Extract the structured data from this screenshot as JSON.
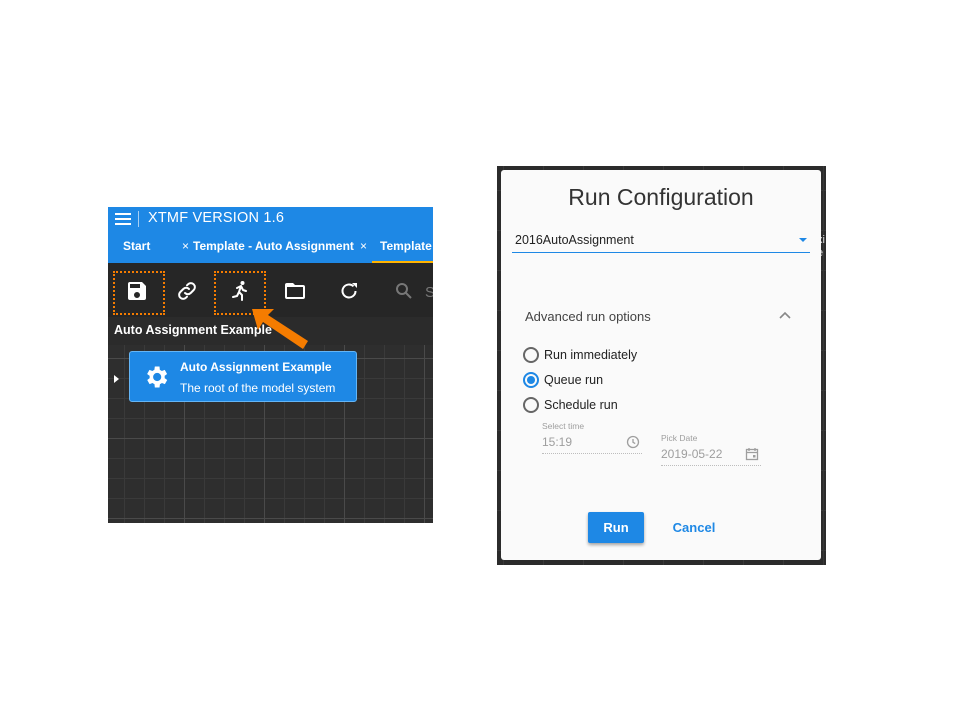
{
  "xtmf": {
    "app_title": "XTMF VERSION 1.6",
    "tabs": [
      {
        "label": "Start",
        "close": "×"
      },
      {
        "label": "Template - Auto Assignment",
        "close": "×"
      },
      {
        "label": "Template"
      }
    ],
    "toolbar": {
      "search_hint": "S"
    },
    "breadcrumb": "Auto Assignment Example",
    "node": {
      "title": "Auto Assignment Example",
      "subtitle": "The root of the model system"
    },
    "highlight_color": "#f57c00",
    "accent_color": "#1e88e5"
  },
  "dialog": {
    "title": "Run Configuration",
    "selected_config": "2016AutoAssignment",
    "advanced_label": "Advanced run options",
    "options": [
      {
        "label": "Run immediately",
        "selected": false
      },
      {
        "label": "Queue run",
        "selected": true
      },
      {
        "label": "Schedule run",
        "selected": false
      }
    ],
    "time_field": {
      "caption": "Select time",
      "value": "15:19"
    },
    "date_field": {
      "caption": "Pick Date",
      "value": "2019-05-22"
    },
    "run_label": "Run",
    "cancel_label": "Cancel",
    "edge_text": "xi\ne"
  }
}
